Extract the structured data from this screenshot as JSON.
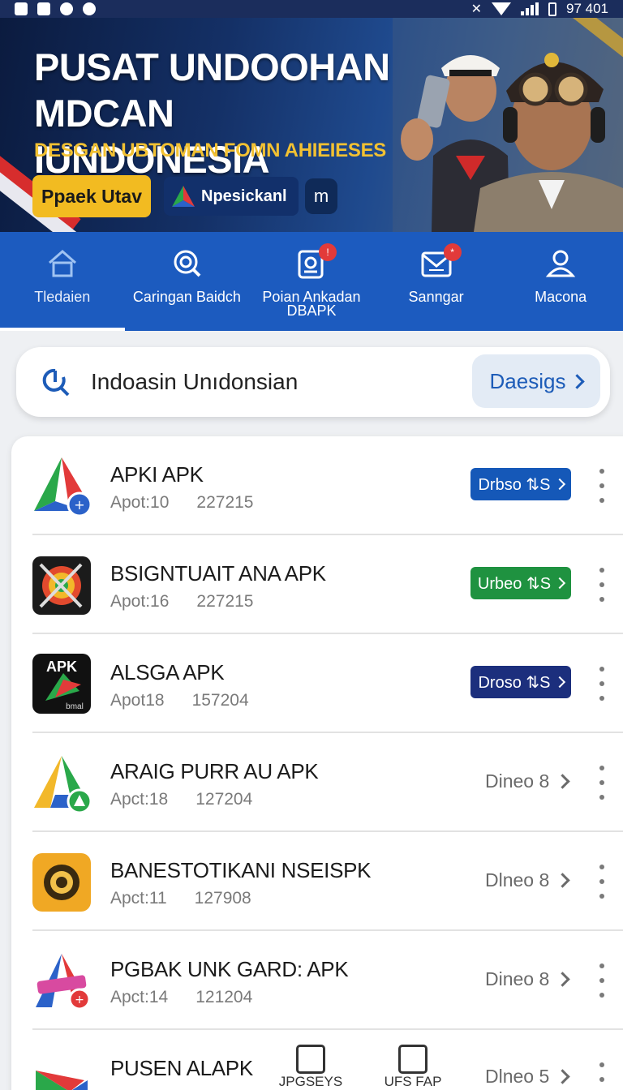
{
  "status_bar": {
    "time": "97 401"
  },
  "banner": {
    "title_line1": "PUSAT UNDOOHAN",
    "title_line2": "MDCAN IUNDONESIA",
    "subtitle": "DESGAN UBTOMAN FOMN AHIEIESES",
    "button_label": "Ppaek Utav",
    "chip_label": "Npesickanl",
    "circle_glyph": "m"
  },
  "nav": {
    "items": [
      {
        "label": "Tledaien",
        "icon": "home-icon",
        "active": true
      },
      {
        "label": "Caringan Baidch",
        "icon": "search-icon"
      },
      {
        "label": "Poian Ankadan DBAPK",
        "icon": "clipboard-icon",
        "badge": "!"
      },
      {
        "label": "Sanngar",
        "icon": "mail-icon",
        "badge": "*"
      },
      {
        "label": "Macona",
        "icon": "profile-icon"
      }
    ]
  },
  "search": {
    "value": "Indoasin Unıdonsian",
    "button_label": "Daesigs"
  },
  "apps": [
    {
      "title": "APKI APK",
      "meta1": "Apot:10",
      "meta2": "227215",
      "action": "Drbso ⇅S",
      "style": "pill",
      "color": "#1558b8"
    },
    {
      "title": "BSIGNTUAIT ANA APK",
      "meta1": "Apot:16",
      "meta2": "227215",
      "action": "Urbeo ⇅S",
      "style": "pill",
      "color": "#1f9240"
    },
    {
      "title": "ALSGA APK",
      "meta1": "Apot18",
      "meta2": "157204",
      "action": "Droso ⇅S",
      "style": "pill",
      "color": "#1c2f7d"
    },
    {
      "title": "ARAIG PURR AU APK",
      "meta1": "Apct:18",
      "meta2": "127204",
      "action": "Dineo  8",
      "style": "plain"
    },
    {
      "title": "BANESTOTIKANI NSEISPK",
      "meta1": "Apct:11",
      "meta2": "127908",
      "action": "Dlneo  8",
      "style": "plain"
    },
    {
      "title": "PGBAK UNK GARD: APK",
      "meta1": "Apct:14",
      "meta2": "121204",
      "action": "Dineo  8",
      "style": "plain"
    },
    {
      "title": "PUSEN ALAPK",
      "meta1": "",
      "meta2": "",
      "action": "Dlneo  5",
      "style": "plain"
    }
  ],
  "app_icons": {
    "apkl": "APK",
    "apkl_sub": "bmal"
  },
  "bottom_overlay": [
    {
      "label": "JPGSEYS",
      "icon": "image-icon"
    },
    {
      "label": "UFS FAP",
      "icon": "picture-icon"
    }
  ]
}
